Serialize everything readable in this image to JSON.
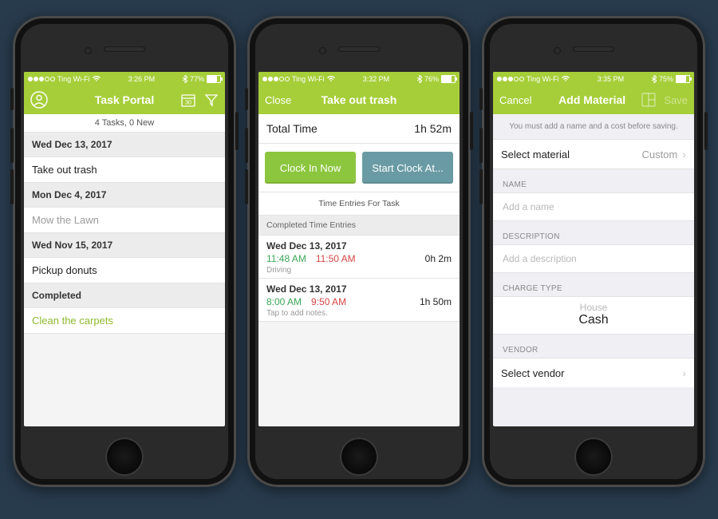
{
  "background": "#283b4d",
  "phone1": {
    "status": {
      "carrier": "Ting Wi-Fi",
      "time": "3:26 PM",
      "battery": "77%"
    },
    "nav": {
      "title": "Task Portal"
    },
    "countbar": "4 Tasks, 0 New",
    "list": [
      {
        "type": "section",
        "label": "Wed Dec 13, 2017"
      },
      {
        "type": "item",
        "label": "Take out trash"
      },
      {
        "type": "section",
        "label": "Mon Dec 4, 2017"
      },
      {
        "type": "item",
        "label": "Mow the Lawn",
        "greyed": true
      },
      {
        "type": "section",
        "label": "Wed Nov 15, 2017"
      },
      {
        "type": "item",
        "label": "Pickup donuts"
      },
      {
        "type": "section",
        "label": "Completed"
      },
      {
        "type": "item",
        "label": "Clean the carpets",
        "green": true
      }
    ]
  },
  "phone2": {
    "status": {
      "carrier": "Ting Wi-Fi",
      "time": "3:32 PM",
      "battery": "76%"
    },
    "nav": {
      "left": "Close",
      "title": "Take out trash"
    },
    "total": {
      "label": "Total Time",
      "value": "1h 52m"
    },
    "buttons": {
      "clockin": "Clock In Now",
      "startat": "Start Clock At..."
    },
    "entriesHeader": "Time Entries For Task",
    "completedHeader": "Completed Time Entries",
    "entries": [
      {
        "date": "Wed Dec 13, 2017",
        "in": "11:48 AM",
        "out": "11:50 AM",
        "dur": "0h 2m",
        "note": "Driving"
      },
      {
        "date": "Wed Dec 13, 2017",
        "in": "8:00 AM",
        "out": "9:50 AM",
        "dur": "1h 50m",
        "note": "Tap to add notes."
      }
    ]
  },
  "phone3": {
    "status": {
      "carrier": "Ting Wi-Fi",
      "time": "3:35 PM",
      "battery": "75%"
    },
    "nav": {
      "left": "Cancel",
      "title": "Add Material",
      "right": "Save"
    },
    "hint": "You must add a name and a cost before saving.",
    "selectMaterial": {
      "label": "Select material",
      "value": "Custom"
    },
    "name": {
      "label": "NAME",
      "placeholder": "Add a name"
    },
    "description": {
      "label": "DESCRIPTION",
      "placeholder": "Add a description"
    },
    "chargeType": {
      "label": "CHARGE TYPE",
      "above": "House",
      "selected": "Cash"
    },
    "vendor": {
      "label": "VENDOR",
      "row": "Select vendor"
    }
  }
}
